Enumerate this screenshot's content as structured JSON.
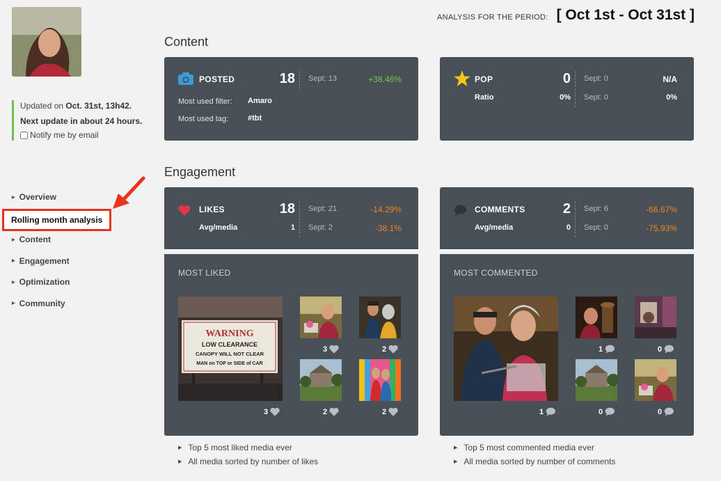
{
  "sidebar": {
    "status": {
      "updated_prefix": "Updated on",
      "updated_date": "Oct. 31st, 13h42.",
      "next_update": "Next update in about 24 hours.",
      "notify_label": "Notify me by email"
    },
    "nav": [
      {
        "label": "Overview"
      },
      {
        "label": "Rolling month analysis",
        "active": true
      },
      {
        "label": "Content"
      },
      {
        "label": "Engagement"
      },
      {
        "label": "Optimization"
      },
      {
        "label": "Community"
      }
    ],
    "highlight_color": "#e8341c"
  },
  "header": {
    "period_label": "ANALYSIS FOR THE PERIOD:",
    "period_value": "[ Oct 1st - Oct 31st ]"
  },
  "sections": {
    "content_title": "Content",
    "engagement_title": "Engagement"
  },
  "posted": {
    "label": "POSTED",
    "value": "18",
    "prev": "Sept: 13",
    "change": "+38.46%",
    "filter_label": "Most used filter:",
    "filter_value": "Amaro",
    "tag_label": "Most used tag:",
    "tag_value": "#tbt"
  },
  "pop": {
    "label": "POP",
    "value": "0",
    "prev": "Sept: 0",
    "change": "N/A",
    "ratio_label": "Ratio",
    "ratio_value": "0%",
    "ratio_prev": "Sept: 0",
    "ratio_change": "0%"
  },
  "likes": {
    "label": "LIKES",
    "value": "18",
    "prev": "Sept: 21",
    "change": "-14.29%",
    "avg_label": "Avg/media",
    "avg_value": "1",
    "avg_prev": "Sept: 2",
    "avg_change": "-38.1%"
  },
  "comments": {
    "label": "COMMENTS",
    "value": "2",
    "prev": "Sept: 6",
    "change": "-66.67%",
    "avg_label": "Avg/media",
    "avg_value": "0",
    "avg_prev": "Sept: 0",
    "avg_change": "-75.93%"
  },
  "most_liked": {
    "title": "MOST LIKED",
    "big_count": "3",
    "warning_sign": [
      "WARNING",
      "LOW CLEARANCE",
      "CANOPY WILL NOT CLEAR",
      "MAN on TOP or SIDE of CAR"
    ],
    "counts": [
      "3",
      "2",
      "2",
      "2"
    ],
    "links": [
      "Top 5 most liked media ever",
      "All media sorted by number of likes"
    ]
  },
  "most_commented": {
    "title": "MOST COMMENTED",
    "big_count": "1",
    "counts": [
      "1",
      "0",
      "0",
      "0"
    ],
    "links": [
      "Top 5 most commented media ever",
      "All media sorted by number of comments"
    ]
  },
  "colors": {
    "card_bg": "#474f57",
    "positive": "#7ac943",
    "negative": "#f5841f",
    "status_bar": "#6cc24a",
    "camera_icon": "#3d9ad6",
    "star_icon": "#f5c518",
    "heart_icon": "#e0354a"
  },
  "icons": [
    "camera-icon",
    "star-icon",
    "heart-icon",
    "speech-bubble-icon"
  ]
}
